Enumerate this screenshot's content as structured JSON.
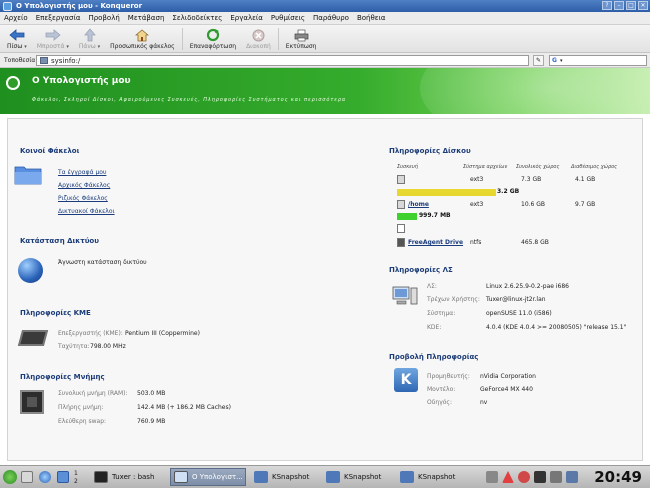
{
  "window": {
    "title": "Ο Υπολογιστής μου - Konqueror"
  },
  "menu": [
    "Αρχείο",
    "Επεξεργασία",
    "Προβολή",
    "Μετάβαση",
    "Σελιδοδείκτες",
    "Εργαλεία",
    "Ρυθμίσεις",
    "Παράθυρο",
    "Βοήθεια"
  ],
  "toolbar": {
    "back": "Πίσω",
    "forward_page": "Μπροστά",
    "up": "Πάνω",
    "home": "Προσωπικός φάκελος",
    "reload": "Επαναφόρτωση",
    "stop": "Διακοπή",
    "print": "Εκτύπωση"
  },
  "location": {
    "label": "Τοποθεσία:",
    "url": "sysinfo:/"
  },
  "banner": {
    "title": "Ο Υπολογιστής μου",
    "subtitle": "Φάκελοι, Σκληροί Δίσκοι, Αφαιρούμενες Συσκευές, Πληροφορίες Συστήματος και περισσότερα"
  },
  "folders": {
    "heading": "Κοινοί Φάκελοι",
    "links": [
      "Τα έγγραφά μου",
      "Αρχικός Φάκελος",
      "Ριζικός Φάκελος",
      "Δικτυακοί Φάκελοι"
    ]
  },
  "network": {
    "heading": "Κατάσταση Δικτύου",
    "status": "Άγνωστη κατάσταση δικτύου"
  },
  "cpu": {
    "heading": "Πληροφορίες ΚΜΕ",
    "model_label": "Επεξεργαστής (ΚΜΕ):",
    "model": "Pentium III (Coppermine)",
    "speed_label": "Ταχύτητα:",
    "speed": "798.00 MHz"
  },
  "memory": {
    "heading": "Πληροφορίες Μνήμης",
    "total_label": "Συνολική μνήμη (RAM):",
    "total": "503.0 MB",
    "free_label": "Πλήρης μνήμη:",
    "free": "142.4 MB (+ 186.2 MB Caches)",
    "swap_label": "Ελεύθερη swap:",
    "swap": "760.9 MB"
  },
  "disks": {
    "heading": "Πληροφορίες Δίσκου",
    "columns": [
      "Συσκευή",
      "Σύστημα αρχείων",
      "Συνολικός χώρος",
      "Διαθέσιμος χώρος"
    ],
    "rows": [
      {
        "name": "",
        "fs": "ext3",
        "total": "7.3 GB",
        "avail": "4.1 GB",
        "bar_label": "3.2 GB",
        "bar_color": "#e6d830",
        "bar_fraction": 0.44
      },
      {
        "name": "/home",
        "fs": "ext3",
        "total": "10.6 GB",
        "avail": "9.7 GB",
        "bar_label": "999.7 MB",
        "bar_color": "#3fd12f",
        "bar_fraction": 0.09
      },
      {
        "name": "FreeAgent Drive",
        "fs": "ntfs",
        "total": "465.8 GB",
        "avail": ""
      }
    ]
  },
  "os": {
    "heading": "Πληροφορίες ΛΣ",
    "rows": [
      {
        "label": "ΛΣ:",
        "value": "Linux 2.6.25.9-0.2-pae i686"
      },
      {
        "label": "Τρέχων Χρήστης:",
        "value": "Tuxer@linux-jt2r.lan"
      },
      {
        "label": "Σύστημα:",
        "value": "openSUSE 11.0 (i586)"
      },
      {
        "label": "KDE:",
        "value": "4.0.4 (KDE 4.0.4 >= 20080505) \"release 15.1\""
      }
    ]
  },
  "display": {
    "heading": "Προβολή Πληροφορίας",
    "rows": [
      {
        "label": "Προμηθευτής:",
        "value": "nVidia Corporation"
      },
      {
        "label": "Μοντέλο:",
        "value": "GeForce4 MX 440"
      },
      {
        "label": "Οδηγός:",
        "value": "nv"
      }
    ]
  },
  "taskbar": {
    "desktop_num": "1",
    "desktop_num2": "2",
    "tasks": [
      "Tuxer : bash",
      "Ο Υπολογιστ...",
      "KSnapshot",
      "KSnapshot",
      "KSnapshot"
    ],
    "clock": "20:49"
  }
}
